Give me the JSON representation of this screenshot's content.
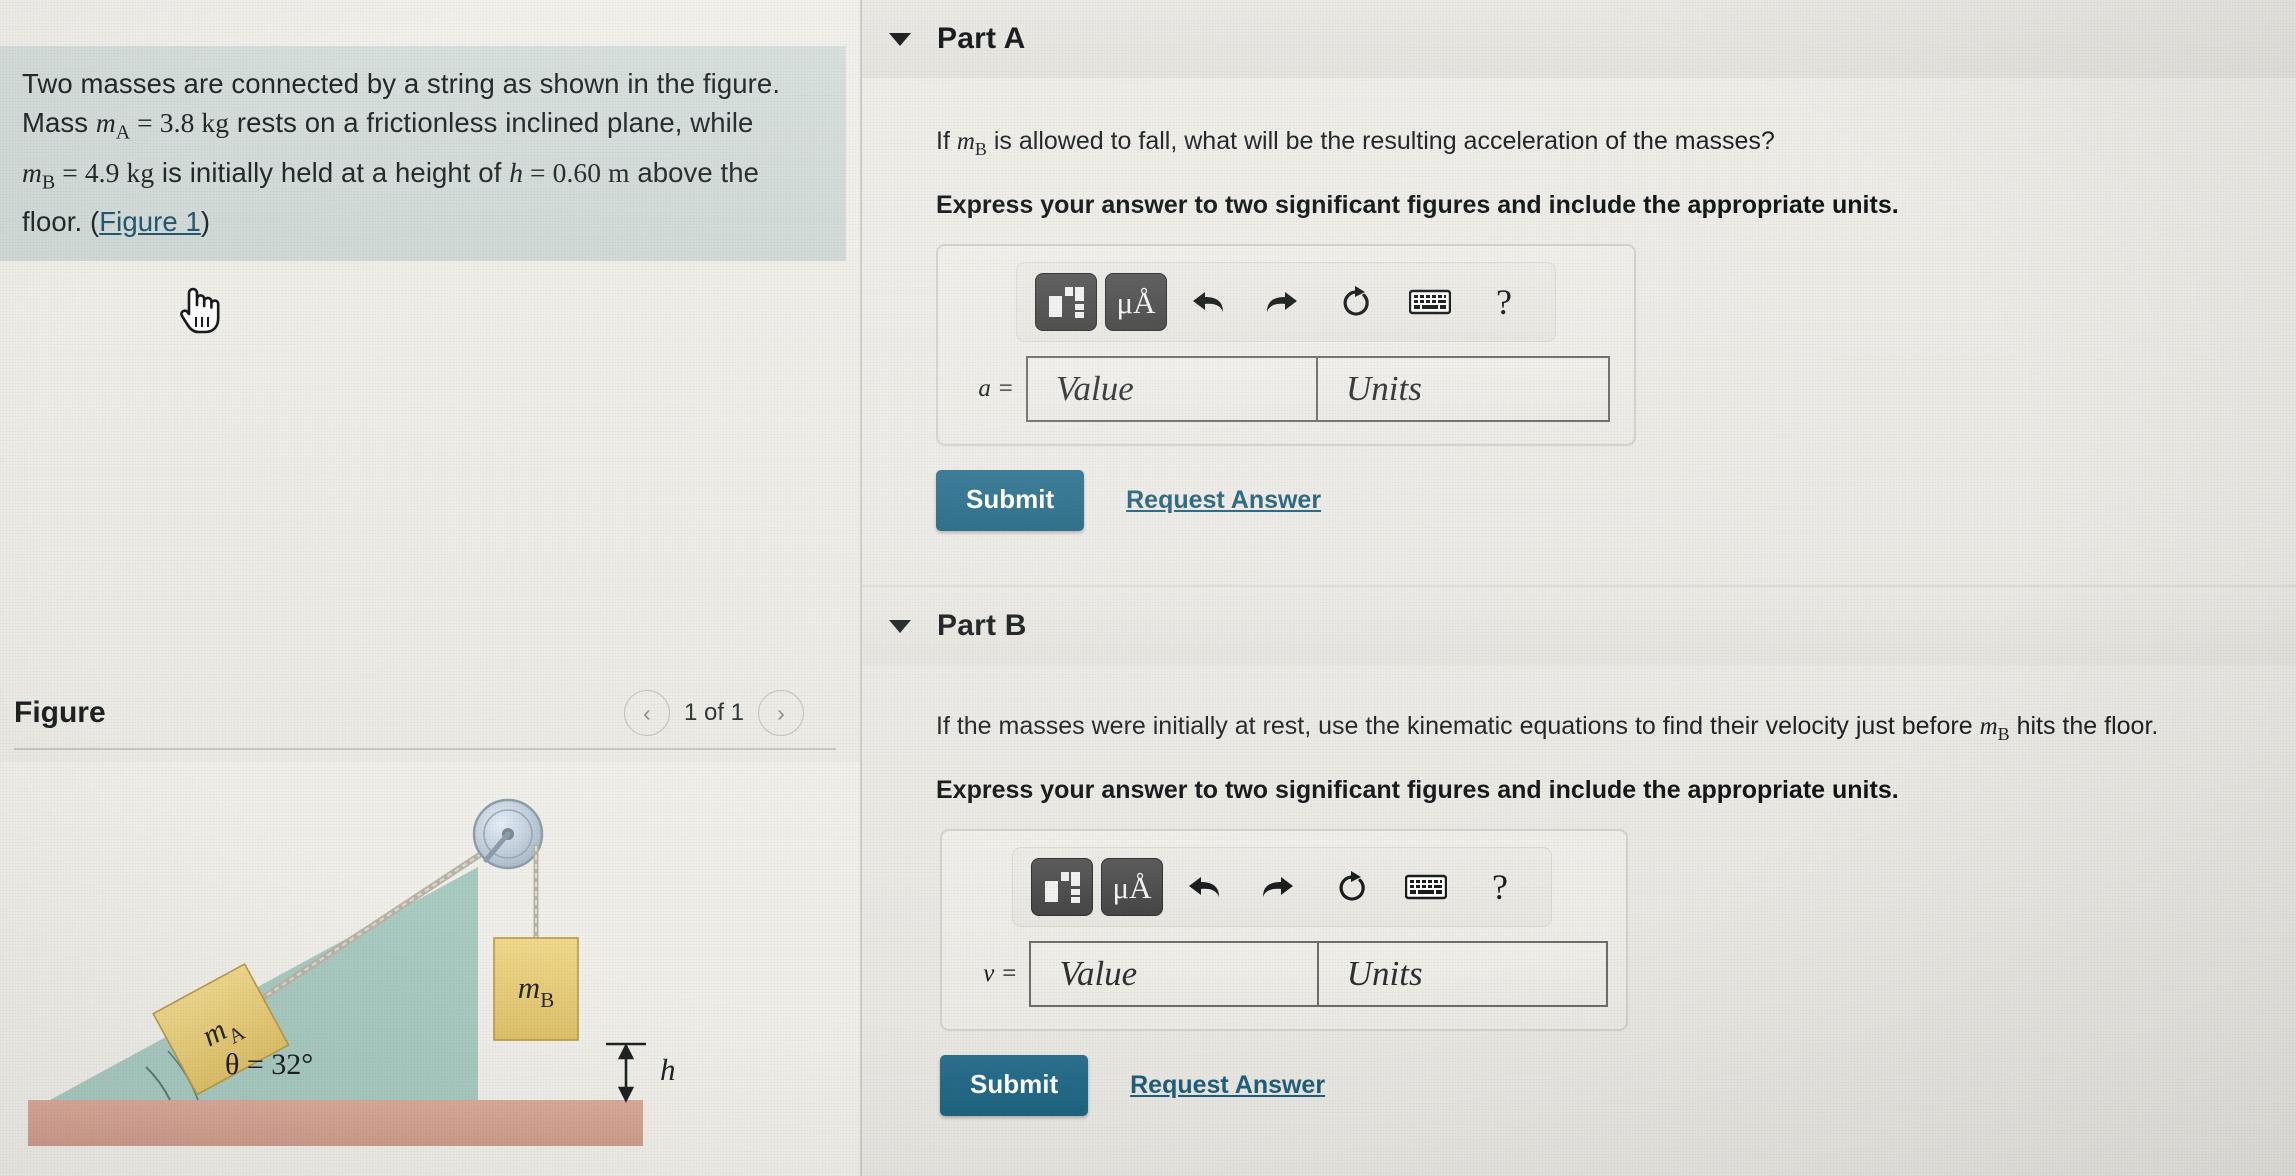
{
  "problem": {
    "line1": "Two masses are connected by a string as shown in the figure.",
    "line2_pre": "Mass ",
    "mass_a_sym": "m",
    "mass_a_sub": "A",
    "mass_a_eq": " = 3.8 kg",
    "line2_post": " rests on a frictionless inclined plane, while",
    "mass_b_sym": "m",
    "mass_b_sub": "B",
    "mass_b_eq": " = 4.9 kg",
    "line3_post": " is initially held at a height of ",
    "h_sym": "h",
    "h_eq": " = 0.60 m",
    "line3_tail": " above the",
    "line4": "floor. (",
    "figure_link": "Figure 1",
    "line4_close": ")"
  },
  "figure_panel": {
    "title": "Figure",
    "prev_icon": "chevron-left-icon",
    "next_icon": "chevron-right-icon",
    "counter": "1 of 1"
  },
  "figure_diagram": {
    "mass_a_label_sym": "m",
    "mass_a_label_sub": "A",
    "mass_b_label_sym": "m",
    "mass_b_label_sub": "B",
    "angle_label": "θ = 32°",
    "height_label": "h",
    "incline_color": "#9fc5bd",
    "block_color": "#e8cd7a",
    "floor_color": "#d9a898",
    "pulley_color": "#c3cfdc"
  },
  "cursor": {
    "icon": "pointing-hand-cursor"
  },
  "toolbar_icons": [
    {
      "name": "math-template-icon",
      "label": ""
    },
    {
      "name": "micro-angstrom-units-icon",
      "label": "μÅ"
    },
    {
      "name": "undo-icon",
      "label": "↶"
    },
    {
      "name": "redo-icon",
      "label": "↷"
    },
    {
      "name": "reset-icon",
      "label": "⟳"
    },
    {
      "name": "keyboard-icon",
      "label": ""
    },
    {
      "name": "help-icon",
      "label": "?"
    }
  ],
  "parts": [
    {
      "id": "part-a",
      "toggle_icon": "chevron-down-icon",
      "label": "Part A",
      "question_pre": "If ",
      "question_sym": "m",
      "question_sub": "B",
      "question_post": " is allowed to fall, what will be the resulting acceleration of the masses?",
      "instruction": "Express your answer to two significant figures and include the appropriate units.",
      "eq_symbol": "a =",
      "value_placeholder": "Value",
      "units_placeholder": "Units",
      "value_current": "",
      "units_current": "",
      "submit_label": "Submit",
      "request_label": "Request Answer"
    },
    {
      "id": "part-b",
      "toggle_icon": "chevron-down-icon",
      "label": "Part B",
      "question_pre": "If the masses were initially at rest, use the kinematic equations to find their velocity just before ",
      "question_sym": "m",
      "question_sub": "B",
      "question_post": " hits the floor.",
      "instruction": "Express your answer to two significant figures and include the appropriate units.",
      "eq_symbol": "v =",
      "value_placeholder": "Value",
      "units_placeholder": "Units",
      "value_current": "",
      "units_current": "",
      "submit_label": "Submit",
      "request_label": "Request Answer"
    }
  ],
  "colors": {
    "accent_button": "#1d6480",
    "link": "#1e5f7c",
    "problem_bg": "#cfd9d6"
  }
}
